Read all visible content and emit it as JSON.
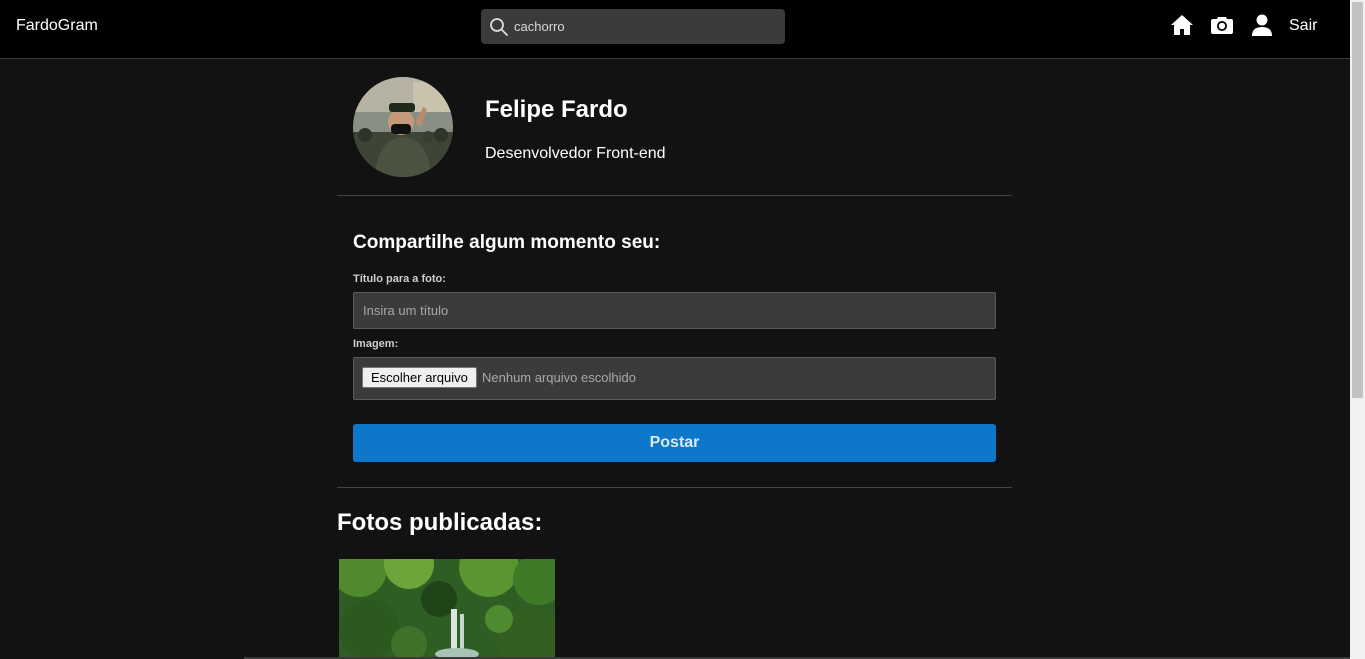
{
  "navbar": {
    "brand": "FardoGram",
    "search": {
      "value": "cachorro",
      "icon": "search-icon"
    },
    "icons": [
      "home-icon",
      "camera-icon",
      "user-icon"
    ],
    "logout_label": "Sair"
  },
  "profile": {
    "name": "Felipe Fardo",
    "bio": "Desenvolvedor Front-end"
  },
  "post_form": {
    "title": "Compartilhe algum momento seu:",
    "photo_title_label": "Título para a foto:",
    "photo_title_placeholder": "Insira um título",
    "image_label": "Imagem:",
    "file_button_label": "Escolher arquivo",
    "file_status": "Nenhum arquivo escolhido",
    "submit_label": "Postar"
  },
  "photos": {
    "title": "Fotos publicadas:"
  },
  "colors": {
    "background": "#121212",
    "navbar": "#000000",
    "accent": "#0d77c9",
    "input": "#3b3b3b"
  }
}
